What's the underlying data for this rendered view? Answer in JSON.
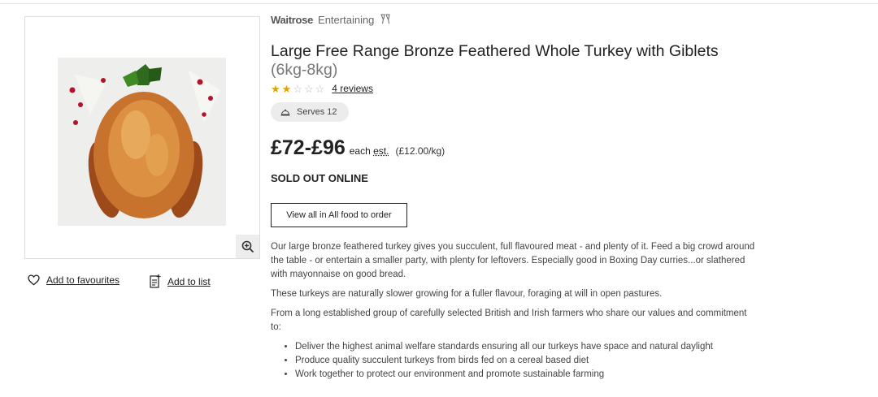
{
  "brand": {
    "name": "Waitrose",
    "sub": "Entertaining",
    "icon": "champagne-glasses-icon"
  },
  "product": {
    "title": "Large Free Range Bronze Feathered Whole Turkey with Giblets",
    "weight": "(6kg-8kg)",
    "rating": 2,
    "rating_max": 5,
    "reviews_label": "4 reviews",
    "serves_label": "Serves 12",
    "serves_icon": "serving-dome-icon",
    "price": "£72-£96",
    "price_each": "each",
    "price_est": "est.",
    "price_per_kg": "(£12.00/kg)",
    "stock_status": "SOLD OUT ONLINE",
    "view_all_button": "View all in All food to order"
  },
  "image": {
    "alt": "roast turkey",
    "zoom_icon": "zoom-in-icon"
  },
  "actions": {
    "favourites_label": "Add to favourites",
    "favourites_icon": "heart-icon",
    "list_label": "Add to list",
    "list_icon": "add-to-list-icon"
  },
  "description": {
    "paragraphs": [
      "Our large bronze feathered turkey gives you succulent, full flavoured meat - and plenty of it. Feed a big crowd around the table - or entertain a smaller party, with plenty for leftovers. Especially good in Boxing Day curries...or slathered with mayonnaise on good bread.",
      "These turkeys are naturally slower growing for a fuller flavour, foraging at will in open pastures.",
      "From a long established group of carefully selected British and Irish farmers who share our values and commitment to:"
    ],
    "bullets": [
      "Deliver the highest animal welfare standards ensuring all our turkeys have space and natural daylight",
      "Produce quality succulent turkeys from birds fed on a cereal based diet",
      "Work together to protect our environment and promote sustainable farming"
    ]
  },
  "colors": {
    "star": "#e2a300",
    "pill_bg": "#ececec",
    "text": "#222222"
  }
}
